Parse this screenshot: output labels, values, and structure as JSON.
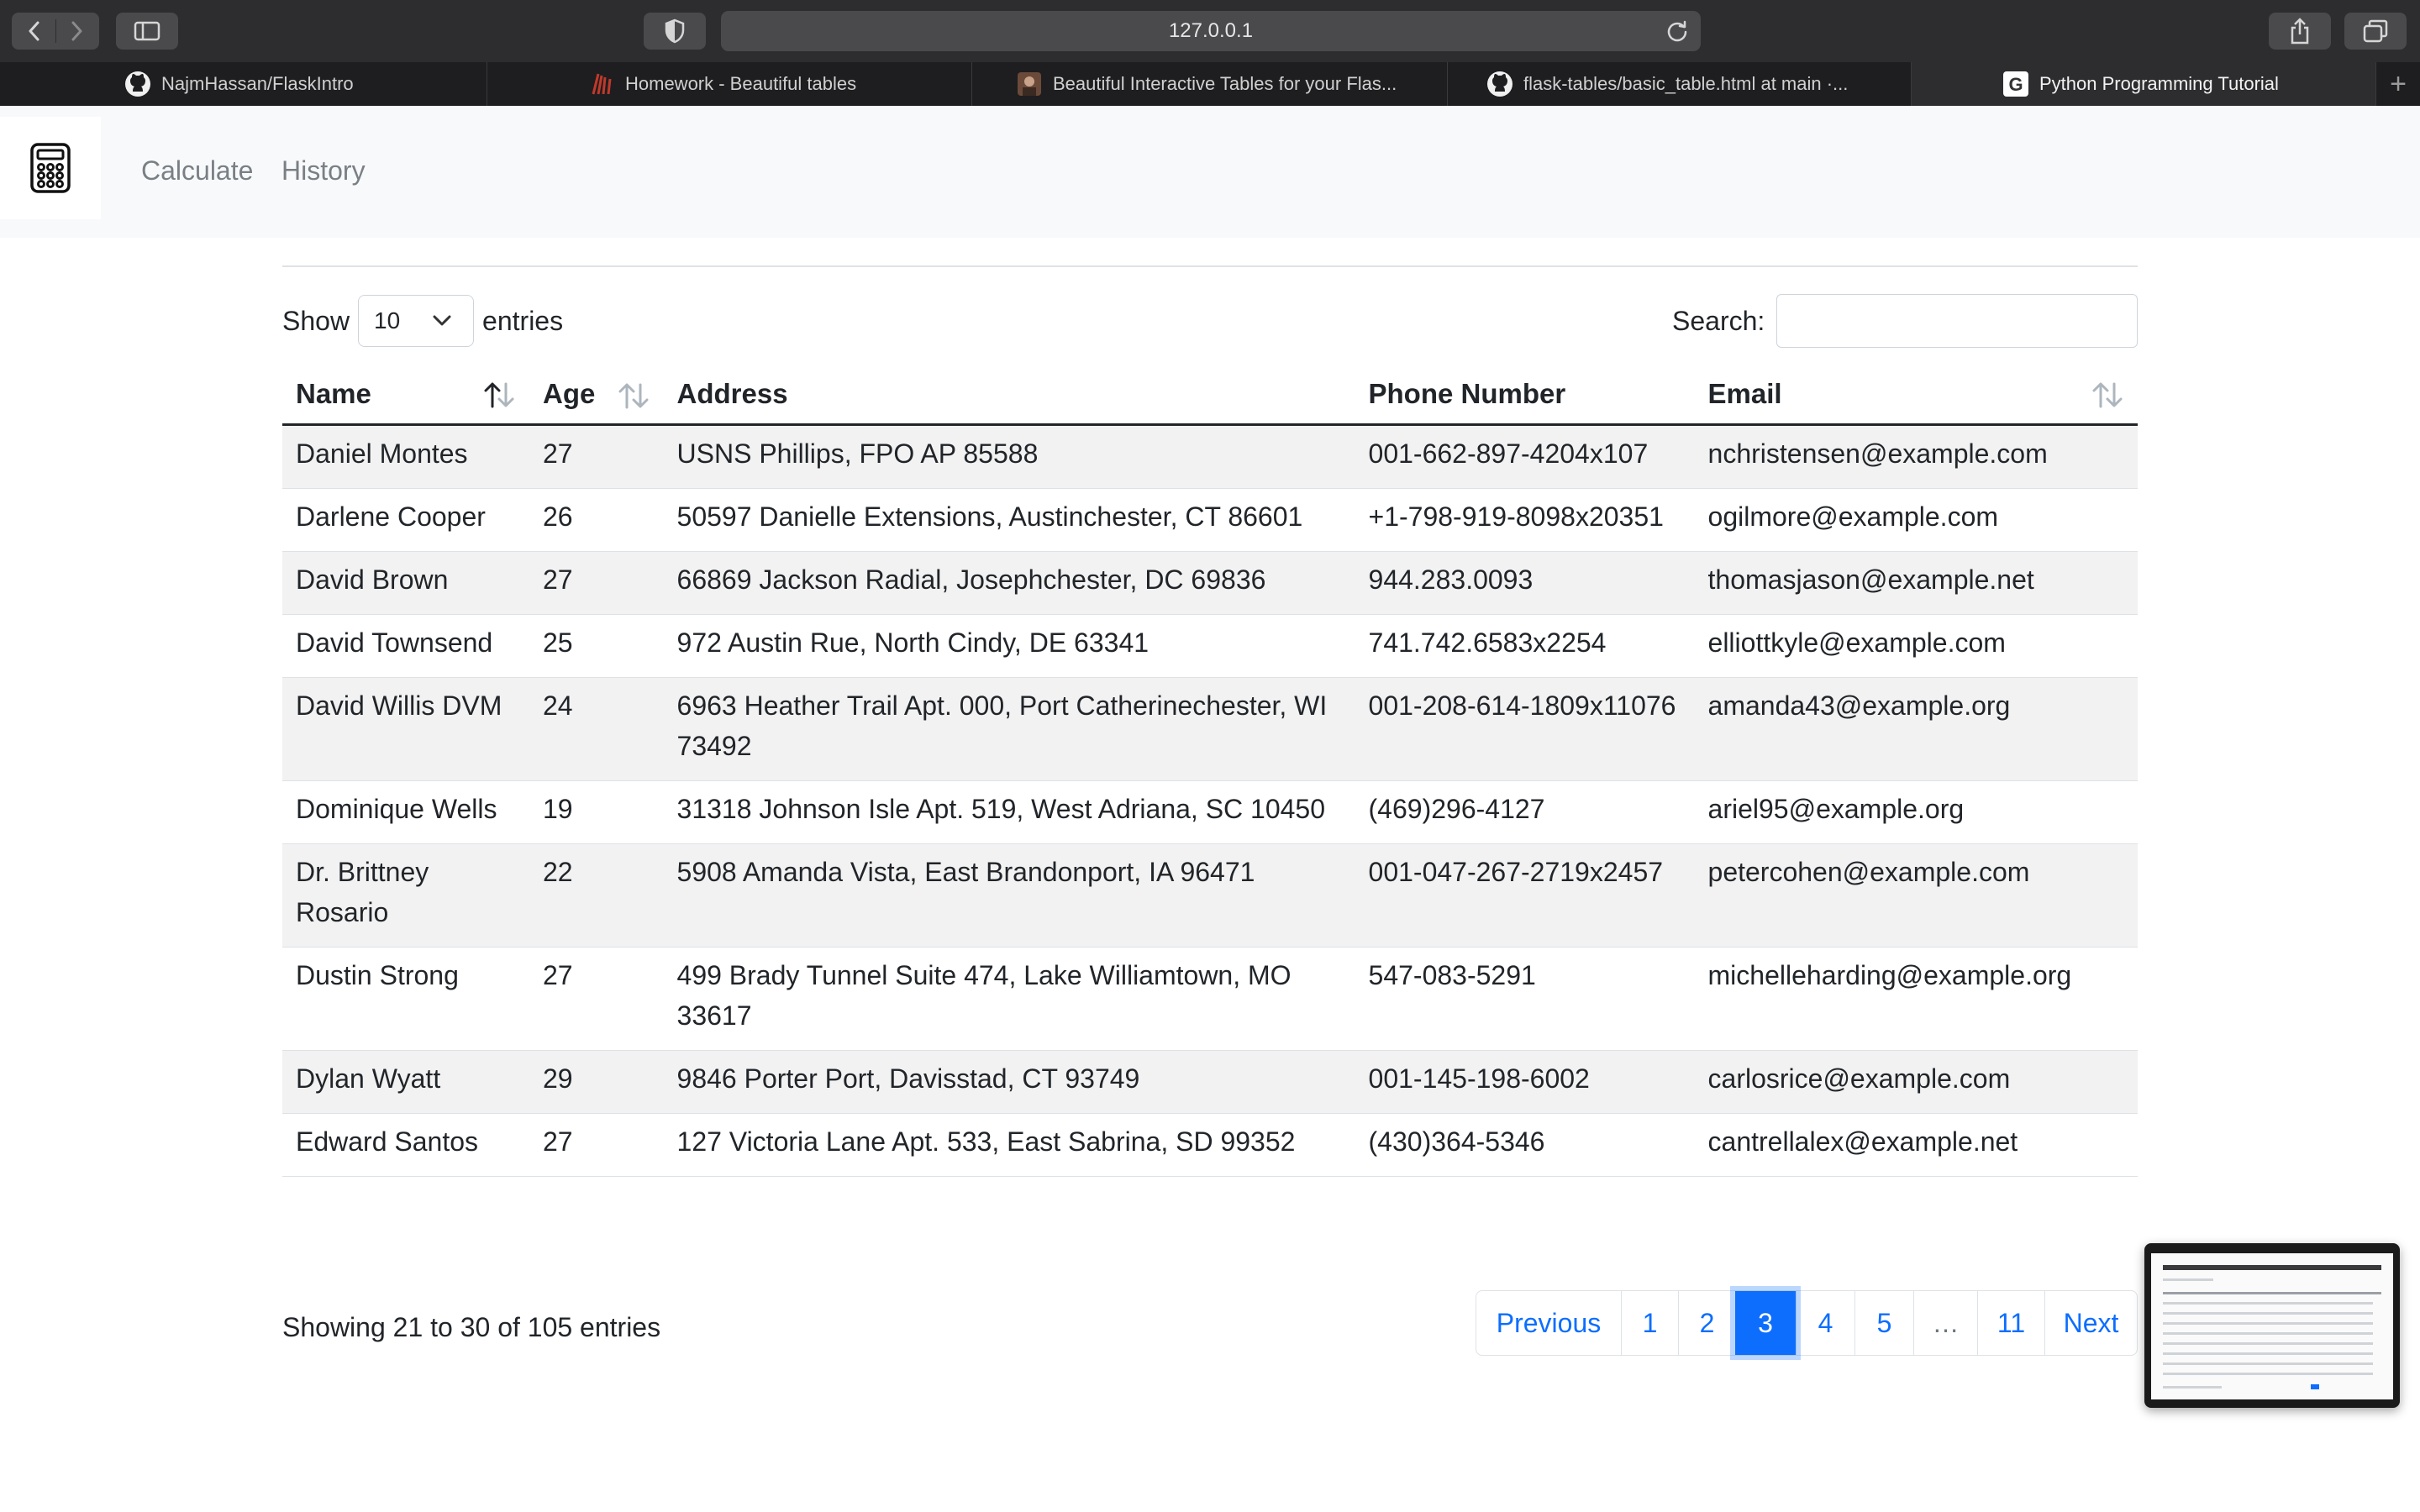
{
  "browser": {
    "url": "127.0.0.1",
    "tabs": [
      {
        "title": "NajmHassan/FlaskIntro",
        "icon": "github-icon",
        "active": false
      },
      {
        "title": "Homework - Beautiful tables",
        "icon": "homework-favicon-icon",
        "active": false
      },
      {
        "title": "Beautiful Interactive Tables for your Flas...",
        "icon": "blog-author-avatar-icon",
        "active": false
      },
      {
        "title": "flask-tables/basic_table.html at main ·...",
        "icon": "github-icon",
        "active": false
      },
      {
        "title": "Python Programming Tutorial",
        "icon": "google-icon",
        "active": true
      }
    ]
  },
  "navbar": {
    "brand_icon": "calculator-icon",
    "links": [
      "Calculate",
      "History"
    ]
  },
  "controls": {
    "show_label": "Show",
    "entries_value": "10",
    "entries_label": "entries",
    "search_label": "Search:",
    "search_value": ""
  },
  "table": {
    "headers": [
      "Name",
      "Age",
      "Address",
      "Phone Number",
      "Email"
    ],
    "rows": [
      [
        "Daniel Montes",
        "27",
        "USNS Phillips, FPO AP 85588",
        "001-662-897-4204x107",
        "nchristensen@example.com"
      ],
      [
        "Darlene Cooper",
        "26",
        "50597 Danielle Extensions, Austinchester, CT 86601",
        "+1-798-919-8098x20351",
        "ogilmore@example.com"
      ],
      [
        "David Brown",
        "27",
        "66869 Jackson Radial, Josephchester, DC 69836",
        "944.283.0093",
        "thomasjason@example.net"
      ],
      [
        "David Townsend",
        "25",
        "972 Austin Rue, North Cindy, DE 63341",
        "741.742.6583x2254",
        "elliottkyle@example.com"
      ],
      [
        "David Willis DVM",
        "24",
        "6963 Heather Trail Apt. 000, Port Catherinechester, WI 73492",
        "001-208-614-1809x11076",
        "amanda43@example.org"
      ],
      [
        "Dominique Wells",
        "19",
        "31318 Johnson Isle Apt. 519, West Adriana, SC 10450",
        "(469)296-4127",
        "ariel95@example.org"
      ],
      [
        "Dr. Brittney Rosario",
        "22",
        "5908 Amanda Vista, East Brandonport, IA 96471",
        "001-047-267-2719x2457",
        "petercohen@example.com"
      ],
      [
        "Dustin Strong",
        "27",
        "499 Brady Tunnel Suite 474, Lake Williamtown, MO 33617",
        "547-083-5291",
        "michelleharding@example.org"
      ],
      [
        "Dylan Wyatt",
        "29",
        "9846 Porter Port, Davisstad, CT 93749",
        "001-145-198-6002",
        "carlosrice@example.com"
      ],
      [
        "Edward Santos",
        "27",
        "127 Victoria Lane Apt. 533, East Sabrina, SD 99352",
        "(430)364-5346",
        "cantrellalex@example.net"
      ]
    ]
  },
  "footer": {
    "info": "Showing 21 to 30 of 105 entries",
    "pagination": [
      "Previous",
      "1",
      "2",
      "3",
      "4",
      "5",
      "…",
      "11",
      "Next"
    ],
    "current_page": "3"
  },
  "colors": {
    "accent": "#0d6efd",
    "stripe": "#f2f2f2",
    "navbar_bg": "#f8f9fa",
    "chrome_bg": "#2d2d2f"
  }
}
